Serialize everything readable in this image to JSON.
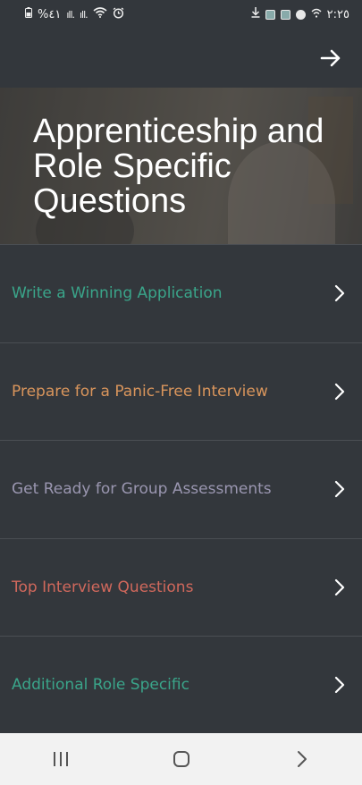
{
  "status_bar": {
    "battery": "%٤١",
    "signal1": "ıll.",
    "signal2": "ıll.",
    "time": "٢:٢٥"
  },
  "app_bar": {
    "forward_icon": "arrow-right-icon"
  },
  "hero": {
    "title": "Apprenticeship and Role Specific Questions"
  },
  "menu": {
    "items": [
      {
        "label": "Write a Winning Application",
        "color": "#3aa58a"
      },
      {
        "label": "Prepare for a Panic-Free Interview",
        "color": "#d9955c"
      },
      {
        "label": "Get Ready for Group Assessments",
        "color": "#9a96b0"
      },
      {
        "label": "Top Interview Questions",
        "color": "#d0685c"
      },
      {
        "label": "Additional Role Specific",
        "color": "#3aa58a"
      }
    ]
  },
  "nav_bar": {
    "icons": [
      "recent-apps-icon",
      "home-icon",
      "back-icon"
    ]
  }
}
